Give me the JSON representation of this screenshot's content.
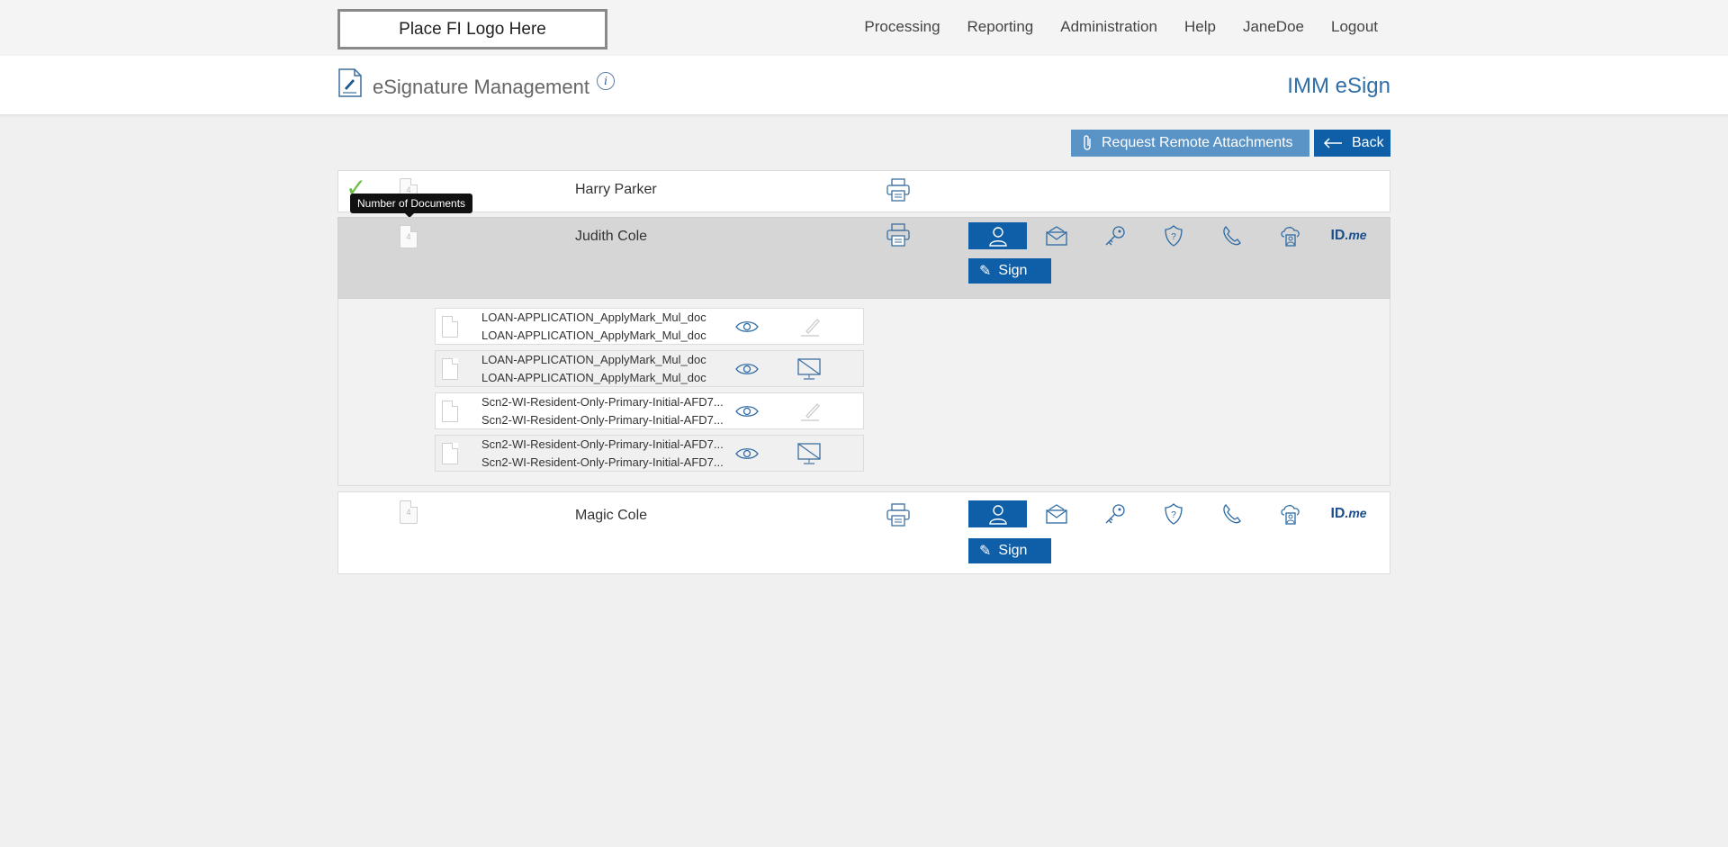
{
  "topbar": {
    "logo_text": "Place FI Logo Here",
    "nav": [
      "Processing",
      "Reporting",
      "Administration",
      "Help",
      "JaneDoe",
      "Logout"
    ]
  },
  "header": {
    "title": "eSignature Management",
    "info_icon": "info-icon",
    "info_glyph": "i",
    "app_name": "IMM eSign"
  },
  "actions": {
    "request_remote_label": "Request Remote Attachments",
    "back_label": "Back"
  },
  "tooltip": "Number of Documents",
  "signers": [
    {
      "name": "Harry Parker",
      "doc_count": "4",
      "completed": true
    },
    {
      "name": "Judith Cole",
      "doc_count": "4",
      "sign_label": "Sign"
    },
    {
      "name": "Magic Cole",
      "doc_count": "4",
      "sign_label": "Sign"
    }
  ],
  "auth_methods": [
    "in-person-icon",
    "email-icon",
    "key-icon",
    "shield-question-icon",
    "phone-icon",
    "cloud-user-icon",
    "id-me-logo"
  ],
  "idme": {
    "id": "ID",
    "me": ".me"
  },
  "documents": [
    {
      "line1": "LOAN-APPLICATION_ApplyMark_Mul_doc",
      "line2": "LOAN-APPLICATION_ApplyMark_Mul_doc",
      "action": "sign-pen-icon"
    },
    {
      "line1": "LOAN-APPLICATION_ApplyMark_Mul_doc",
      "line2": "LOAN-APPLICATION_ApplyMark_Mul_doc",
      "action": "no-display-icon"
    },
    {
      "line1": "Scn2-WI-Resident-Only-Primary-Initial-AFD7...",
      "line2": "Scn2-WI-Resident-Only-Primary-Initial-AFD7...",
      "action": "sign-pen-icon"
    },
    {
      "line1": "Scn2-WI-Resident-Only-Primary-Initial-AFD7...",
      "line2": "Scn2-WI-Resident-Only-Primary-Initial-AFD7...",
      "action": "no-display-icon"
    }
  ],
  "colors": {
    "primary": "#0f5fa8",
    "secondary": "#5a93c6",
    "accent_text": "#2f6fa8",
    "check": "#6cc04a"
  }
}
